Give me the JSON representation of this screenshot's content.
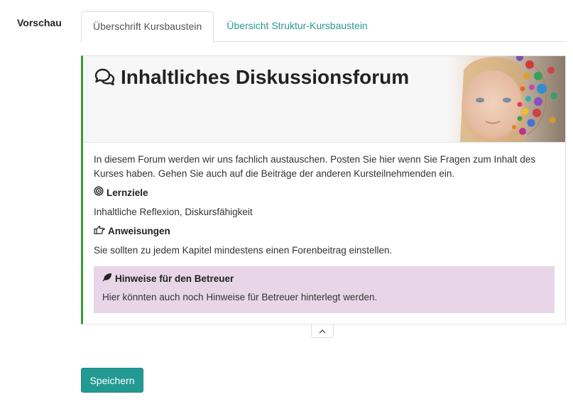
{
  "field": {
    "label": "Vorschau"
  },
  "tabs": [
    {
      "label": "Überschrift Kursbaustein",
      "active": true
    },
    {
      "label": "Übersicht Struktur-Kursbaustein",
      "active": false
    }
  ],
  "preview": {
    "icon": "comments-icon",
    "title": "Inhaltliches Diskussionsforum",
    "intro": "In diesem Forum werden wir uns fachlich austauschen. Posten Sie hier wenn Sie Fragen zum Inhalt des Kurses haben. Gehen Sie auch auf die Beiträge der anderen Kursteilnehmenden ein.",
    "objectives": {
      "icon": "target-icon",
      "heading": "Lernziele",
      "text": "Inhaltliche Reflexion, Diskursfähigkeit"
    },
    "instructions": {
      "icon": "hand-point-right-icon",
      "heading": "Anweisungen",
      "text": "Sie sollten zu jedem Kapitel mindestens einen Forenbeitrag einstellen."
    },
    "coach_hint": {
      "icon": "leaf-icon",
      "heading": "Hinweise für den Betreuer",
      "text": "Hier könnten auch noch Hinweise für Betreuer hinterlegt werden.",
      "background": "#e8d6e8"
    },
    "accent_color": "#3a9a3a"
  },
  "actions": {
    "collapse_icon": "chevron-up-icon",
    "save_label": "Speichern",
    "save_color": "#239a91"
  },
  "colors": {
    "link": "#2a9a8f"
  }
}
